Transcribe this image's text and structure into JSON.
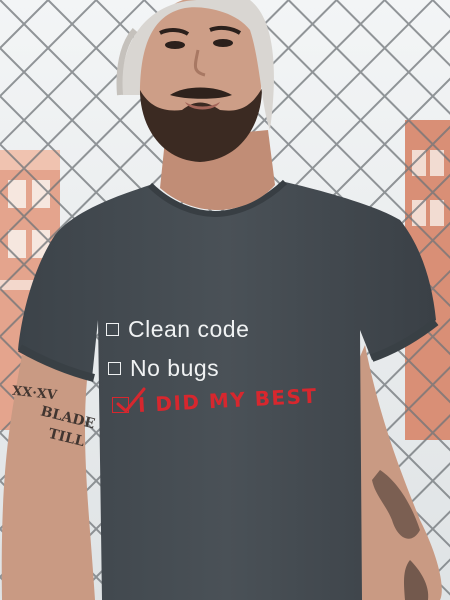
{
  "shirt_print": {
    "items": [
      {
        "label": "Clean code",
        "checked": false
      },
      {
        "label": "No bugs",
        "checked": false
      },
      {
        "label": "I DID MY BEST",
        "checked": true
      }
    ],
    "text_color": "#f0f2f3",
    "highlight_color": "#d7272e"
  },
  "tattoos": {
    "forearm_numeral": "XX·XV",
    "blade_line1": "BLADE",
    "blade_line2": "TILL"
  },
  "colors": {
    "shirt": "#434a50",
    "beanie": "#d9d6d2",
    "skin": "#c99a83",
    "beard": "#3b2a22",
    "fence": "#6f7478",
    "building": "#d98f76"
  }
}
